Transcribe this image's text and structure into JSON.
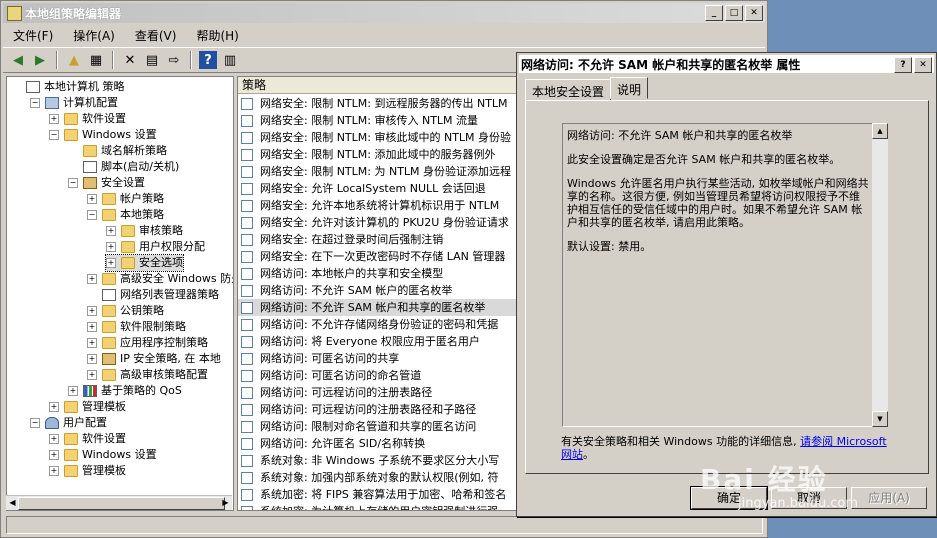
{
  "main_window": {
    "title": "本地组策略编辑器",
    "menu": [
      "文件(F)",
      "操作(A)",
      "查看(V)",
      "帮助(H)"
    ]
  },
  "tree": [
    {
      "label": "本地计算机 策略",
      "level": 0,
      "expander": "",
      "icon": "doc"
    },
    {
      "label": "计算机配置",
      "level": 1,
      "expander": "−",
      "icon": "pc"
    },
    {
      "label": "软件设置",
      "level": 2,
      "expander": "+",
      "icon": "folder"
    },
    {
      "label": "Windows 设置",
      "level": 2,
      "expander": "−",
      "icon": "folder"
    },
    {
      "label": "域名解析策略",
      "level": 3,
      "expander": "",
      "icon": "folder"
    },
    {
      "label": "脚本(启动/关机)",
      "level": 3,
      "expander": "",
      "icon": "doc"
    },
    {
      "label": "安全设置",
      "level": 3,
      "expander": "−",
      "icon": "shield"
    },
    {
      "label": "帐户策略",
      "level": 4,
      "expander": "+",
      "icon": "folder"
    },
    {
      "label": "本地策略",
      "level": 4,
      "expander": "−",
      "icon": "folder"
    },
    {
      "label": "审核策略",
      "level": 5,
      "expander": "+",
      "icon": "folder"
    },
    {
      "label": "用户权限分配",
      "level": 5,
      "expander": "+",
      "icon": "folder"
    },
    {
      "label": "安全选项",
      "level": 5,
      "expander": "+",
      "icon": "folder",
      "selected": true
    },
    {
      "label": "高级安全 Windows 防火",
      "level": 4,
      "expander": "+",
      "icon": "folder"
    },
    {
      "label": "网络列表管理器策略",
      "level": 4,
      "expander": "",
      "icon": "doc"
    },
    {
      "label": "公钥策略",
      "level": 4,
      "expander": "+",
      "icon": "folder"
    },
    {
      "label": "软件限制策略",
      "level": 4,
      "expander": "+",
      "icon": "folder"
    },
    {
      "label": "应用程序控制策略",
      "level": 4,
      "expander": "+",
      "icon": "folder"
    },
    {
      "label": "IP 安全策略, 在 本地",
      "level": 4,
      "expander": "+",
      "icon": "shield"
    },
    {
      "label": "高级审核策略配置",
      "level": 4,
      "expander": "+",
      "icon": "folder"
    },
    {
      "label": "基于策略的 QoS",
      "level": 3,
      "expander": "+",
      "icon": "chart"
    },
    {
      "label": "管理模板",
      "level": 2,
      "expander": "+",
      "icon": "folder"
    },
    {
      "label": "用户配置",
      "level": 1,
      "expander": "−",
      "icon": "users"
    },
    {
      "label": "软件设置",
      "level": 2,
      "expander": "+",
      "icon": "folder"
    },
    {
      "label": "Windows 设置",
      "level": 2,
      "expander": "+",
      "icon": "folder"
    },
    {
      "label": "管理模板",
      "level": 2,
      "expander": "+",
      "icon": "folder"
    }
  ],
  "list": {
    "column_header": "策略",
    "rows": [
      {
        "label": "网络安全: 限制 NTLM: 到远程服务器的传出 NTLM"
      },
      {
        "label": "网络安全: 限制 NTLM: 审核传入 NTLM 流量"
      },
      {
        "label": "网络安全: 限制 NTLM: 审核此域中的 NTLM 身份验"
      },
      {
        "label": "网络安全: 限制 NTLM: 添加此域中的服务器例外"
      },
      {
        "label": "网络安全: 限制 NTLM: 为 NTLM 身份验证添加远程"
      },
      {
        "label": "网络安全: 允许 LocalSystem NULL 会话回退"
      },
      {
        "label": "网络安全: 允许本地系统将计算机标识用于 NTLM"
      },
      {
        "label": "网络安全: 允许对该计算机的 PKU2U 身份验证请求"
      },
      {
        "label": "网络安全: 在超过登录时间后强制注销"
      },
      {
        "label": "网络安全: 在下一次更改密码时不存储 LAN 管理器"
      },
      {
        "label": "网络访问: 本地帐户的共享和安全模型"
      },
      {
        "label": "网络访问: 不允许 SAM 帐户的匿名枚举"
      },
      {
        "label": "网络访问: 不允许 SAM 帐户和共享的匿名枚举",
        "selected": true
      },
      {
        "label": "网络访问: 不允许存储网络身份验证的密码和凭据"
      },
      {
        "label": "网络访问: 将 Everyone 权限应用于匿名用户"
      },
      {
        "label": "网络访问: 可匿名访问的共享"
      },
      {
        "label": "网络访问: 可匿名访问的命名管道"
      },
      {
        "label": "网络访问: 可远程访问的注册表路径"
      },
      {
        "label": "网络访问: 可远程访问的注册表路径和子路径"
      },
      {
        "label": "网络访问: 限制对命名管道和共享的匿名访问"
      },
      {
        "label": "网络访问: 允许匿名 SID/名称转换"
      },
      {
        "label": "系统对象: 非 Windows 子系统不要求区分大小写"
      },
      {
        "label": "系统对象: 加强内部系统对象的默认权限(例如, 符"
      },
      {
        "label": "系统加密: 将 FIPS 兼容算法用于加密、哈希和签名"
      },
      {
        "label": "系统加密: 为计算机上存储的用户密钥强制进行强"
      }
    ]
  },
  "dialog": {
    "title": "网络访问: 不允许 SAM 帐户和共享的匿名枚举 属性",
    "tabs": [
      {
        "label": "本地安全设置"
      },
      {
        "label": "说明"
      }
    ],
    "description": {
      "heading": "网络访问: 不允许 SAM 帐户和共享的匿名枚举",
      "para1": "此安全设置确定是否允许 SAM 帐户和共享的匿名枚举。",
      "para2": "Windows 允许匿名用户执行某些活动, 如枚举域帐户和网络共享的名称。这很方便, 例如当管理员希望将访问权限授予不维护相互信任的受信任域中的用户时。如果不希望允许 SAM 帐户和共享的匿名枚举, 请启用此策略。",
      "para3": "默认设置: 禁用。"
    },
    "link_prefix": "有关安全策略和相关 Windows 功能的详细信息, ",
    "link_text": "请参阅 Microsoft 网站",
    "link_suffix": "。",
    "buttons": {
      "ok": "确定",
      "cancel": "取消",
      "apply": "应用(A)"
    }
  },
  "watermark": {
    "text": "Bai 经验",
    "sub": "jingyan.baidu.com"
  }
}
